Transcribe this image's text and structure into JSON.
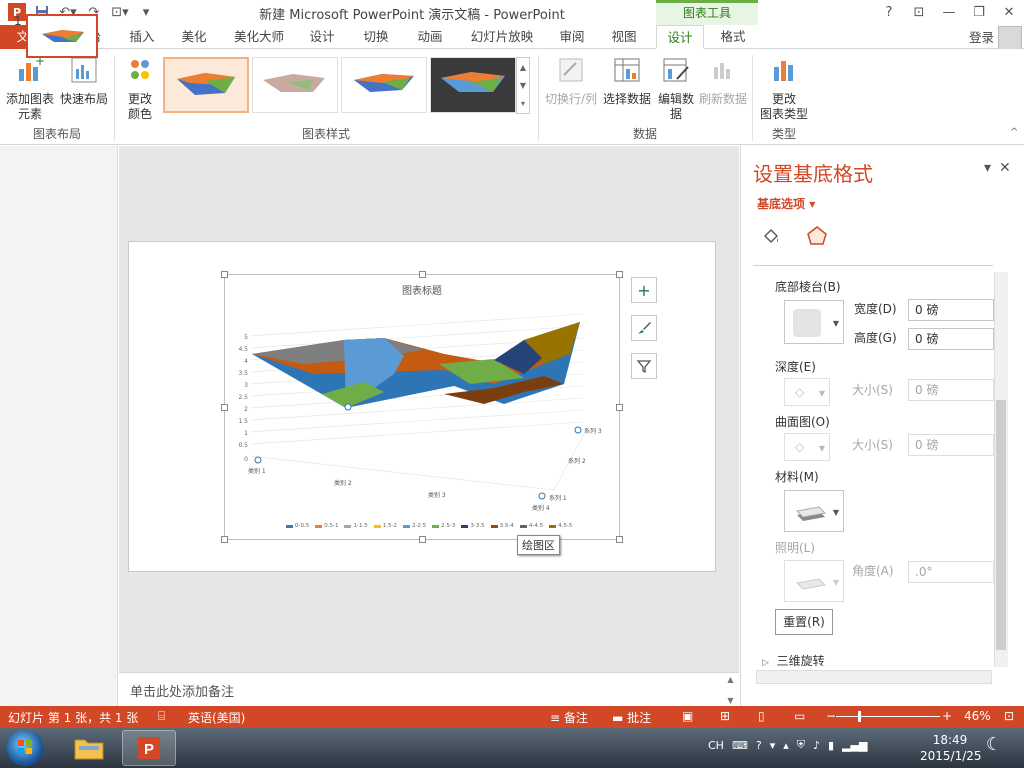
{
  "title_bar": {
    "document_title": "新建 Microsoft PowerPoint 演示文稿 - PowerPoint",
    "contextual_tab": "图表工具",
    "help": "?",
    "restore_ribbon": "⊡",
    "minimize": "—",
    "maximize": "❐",
    "close": "✕"
  },
  "tabs": {
    "file": "文件",
    "home": "开始",
    "insert": "插入",
    "beautify": "美化",
    "beautify_master": "美化大师",
    "design_main": "设计",
    "transitions": "切换",
    "animations": "动画",
    "slideshow": "幻灯片放映",
    "review": "审阅",
    "view": "视图",
    "chart_design": "设计",
    "chart_format": "格式",
    "login": "登录"
  },
  "ribbon": {
    "add_element": "添加图表\n元素",
    "quick_layout": "快速布局",
    "change_colors": "更改\n颜色",
    "group_layout": "图表布局",
    "group_styles": "图表样式",
    "switch_row_col": "切换行/列",
    "select_data": "选择数据",
    "edit_data": "编辑数\n据",
    "refresh_data": "刷新数据",
    "group_data": "数据",
    "change_type": "更改\n图表类型",
    "group_type": "类型"
  },
  "slide": {
    "number": "1",
    "chart_title": "图表标题",
    "tooltip": "绘图区",
    "y_ticks": [
      "5",
      "4.5",
      "4",
      "3.5",
      "3",
      "2.5",
      "2",
      "1.5",
      "1",
      "0.5",
      "0"
    ],
    "categories": [
      "类别 1",
      "类别 2",
      "类别 3",
      "类别 4"
    ],
    "series_axis": [
      "系列 1",
      "系列 2",
      "系列 3"
    ],
    "legend": [
      "0-0.5",
      "0.5-1",
      "1-1.5",
      "1.5-2",
      "2-2.5",
      "2.5-3",
      "3-3.5",
      "3.5-4",
      "4-4.5",
      "4.5-5"
    ],
    "legend_colors": [
      "#4472c4",
      "#ed7d31",
      "#a5a5a5",
      "#ffc000",
      "#5b9bd5",
      "#70ad47",
      "#264478",
      "#9e480e",
      "#636363",
      "#997300"
    ]
  },
  "notes": {
    "placeholder": "单击此处添加备注"
  },
  "format_pane": {
    "title": "设置基底格式",
    "subtitle": "基底选项",
    "bevel_bottom": "底部棱台(B)",
    "width_label": "宽度(D)",
    "width_value": "0 磅",
    "height_label": "高度(G)",
    "height_value": "0 磅",
    "depth_label": "深度(E)",
    "depth_size_label": "大小(S)",
    "depth_size_value": "0 磅",
    "contour_label": "曲面图(O)",
    "contour_size_label": "大小(S)",
    "contour_size_value": "0 磅",
    "material_label": "材料(M)",
    "lighting_label": "照明(L)",
    "angle_label": "角度(A)",
    "angle_value": ".0°",
    "reset": "重置(R)",
    "rotation_section": "三维旋转"
  },
  "status": {
    "slide_info": "幻灯片 第 1 张，共 1 张",
    "language": "英语(美国)",
    "notes": "备注",
    "comments": "批注",
    "zoom": "46%"
  },
  "taskbar": {
    "lang": "CH",
    "time": "18:49",
    "date": "2015/1/25"
  }
}
